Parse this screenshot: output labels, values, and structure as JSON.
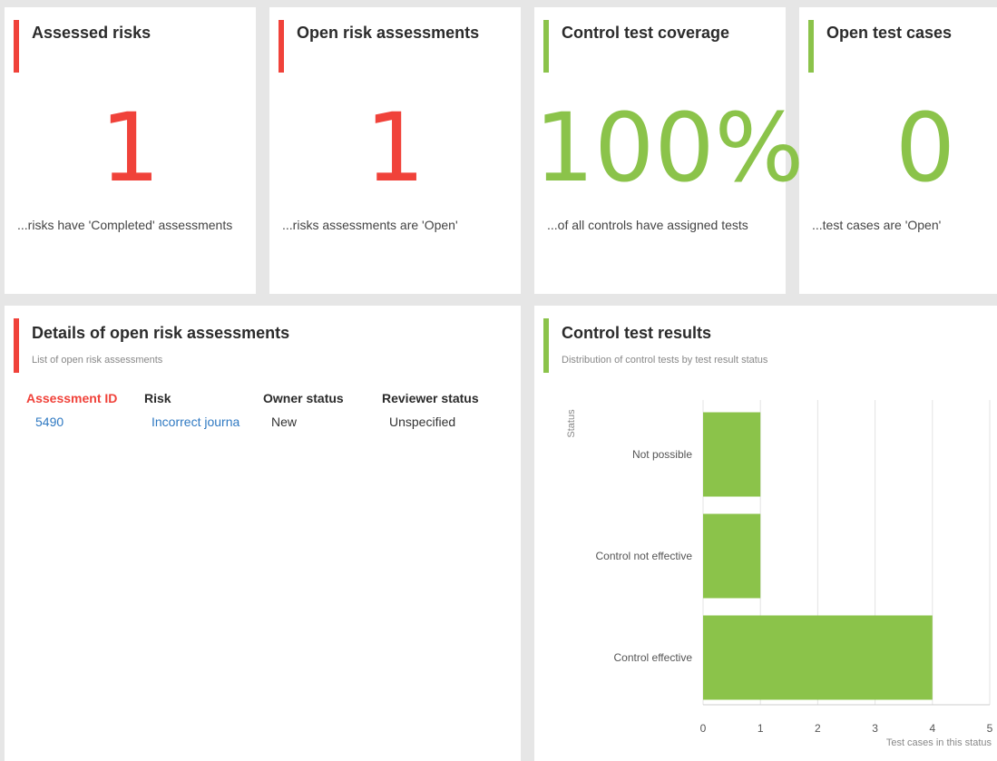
{
  "kpis": [
    {
      "title": "Assessed risks",
      "value": "1",
      "caption": "...risks have 'Completed' assessments",
      "color": "#f0423a"
    },
    {
      "title": "Open risk assessments",
      "value": "1",
      "caption": "...risks assessments are 'Open'",
      "color": "#f0423a"
    },
    {
      "title": "Control test coverage",
      "value": "100%",
      "caption": "...of all controls have assigned tests",
      "color": "#8bc34a"
    },
    {
      "title": "Open test cases",
      "value": "0",
      "caption": "...test cases are 'Open'",
      "color": "#8bc34a"
    }
  ],
  "details": {
    "title": "Details of open risk assessments",
    "subtitle": "List of open risk assessments",
    "columns": [
      "Assessment ID",
      "Risk",
      "Owner status",
      "Reviewer status"
    ],
    "rows": [
      {
        "id": "5490",
        "risk": "Incorrect journa",
        "owner_status": "New",
        "reviewer_status": "Unspecified"
      }
    ]
  },
  "results": {
    "title": "Control test results",
    "subtitle": "Distribution of control tests by test result status"
  },
  "chart_data": {
    "type": "bar",
    "orientation": "horizontal",
    "categories": [
      "Not possible",
      "Control not effective",
      "Control effective"
    ],
    "values": [
      1,
      1,
      4
    ],
    "xlabel": "Test cases in this status",
    "ylabel": "Status",
    "xlim": [
      0,
      5
    ],
    "xticks": [
      "0",
      "1",
      "2",
      "3",
      "4",
      "5"
    ],
    "bar_color": "#8bc34a",
    "grid": true
  }
}
